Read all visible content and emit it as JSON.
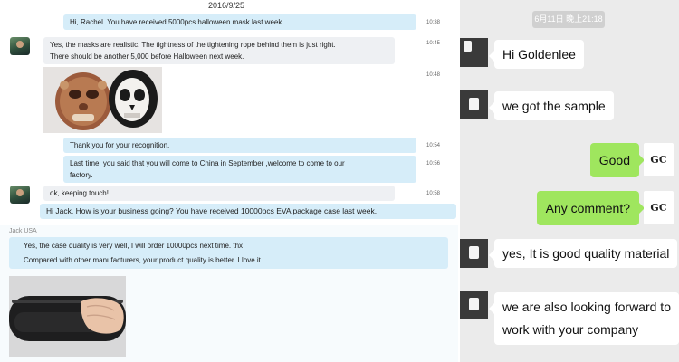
{
  "left_chat": {
    "date": "2016/9/25",
    "messages": [
      {
        "lines": [
          "Hi, Rachel. You have received 5000pcs halloween mask last week."
        ],
        "time": "10:38"
      },
      {
        "lines": [
          "Yes, the masks are realistic. The tightness of the tightening rope behind them is just right.",
          "There should be another 5,000 before Halloween next week."
        ],
        "time": "10:45"
      },
      {
        "image": "halloween-masks-photo",
        "time": "10:48"
      },
      {
        "lines": [
          "Thank you for your recognition."
        ],
        "time": "10:54"
      },
      {
        "lines": [
          "Last time, you said that you will come to China in September ,welcome to come to our",
          "factory."
        ],
        "time": "10:56"
      },
      {
        "lines": [
          "ok, keeping touch!"
        ],
        "time": "10:58"
      },
      {
        "lines": [
          "Hi Jack, How is your business going? You have received 10000pcs EVA package case last week."
        ]
      },
      {
        "lines": [
          "Yes, the case quality is very well, I will order 10000pcs next time. thx",
          "Compared with other manufacturers, your product quality is better. I love it."
        ]
      },
      {
        "image": "eva-case-photo"
      }
    ],
    "sender_name": "Jack USA"
  },
  "right_chat": {
    "time_badge": "6月11日 晚上21:18",
    "messages": [
      {
        "side": "left",
        "lines": [
          "Hi Goldenlee"
        ]
      },
      {
        "side": "left",
        "lines": [
          "we got the sample"
        ]
      },
      {
        "side": "right",
        "lines": [
          "Good"
        ]
      },
      {
        "side": "right",
        "lines": [
          "Any comment?"
        ]
      },
      {
        "side": "left",
        "lines": [
          "yes, It is good quality material"
        ]
      },
      {
        "side": "left",
        "lines": [
          "we are also looking forward to",
          "work with your company"
        ]
      }
    ],
    "self_avatar_text": "GC",
    "colors": {
      "self_bubble": "#9fe65e",
      "other_bubble": "#ffffff",
      "background": "#ebebeb"
    }
  },
  "colors": {
    "desktop_bubble": "#d6edf9",
    "desktop_bubble_grey": "#eef0f3"
  }
}
